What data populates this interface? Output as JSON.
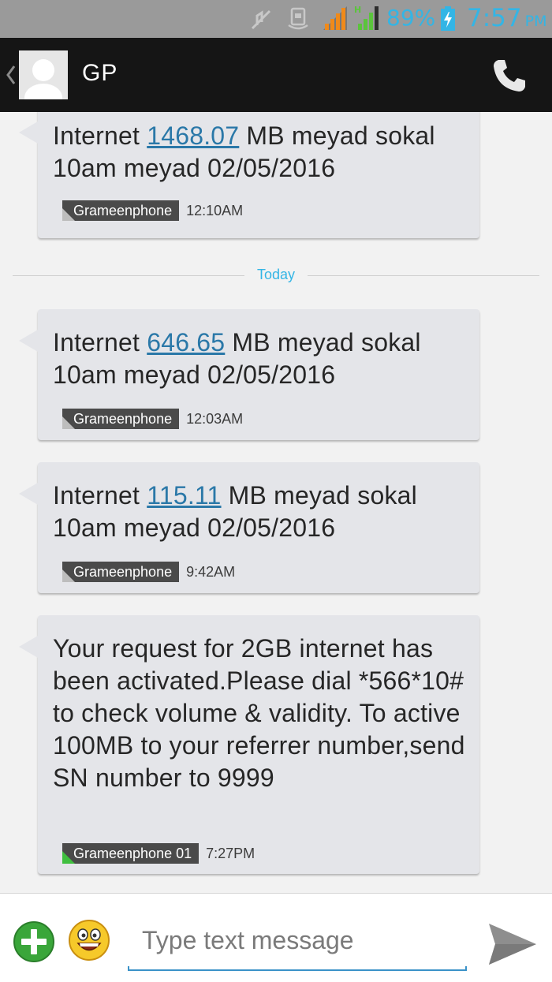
{
  "status_bar": {
    "battery_percent": "89%",
    "time": "7:57",
    "ampm": "PM",
    "network_type": "H",
    "accent_color": "#33b5e5"
  },
  "header": {
    "contact_name": "GP"
  },
  "messages": [
    {
      "prefix": "Internet ",
      "link": "1468.07",
      "suffix": " MB meyad sokal 10am meyad 02/05/2016",
      "sim": "Grameenphone",
      "time": "12:10AM"
    },
    {
      "prefix": "Internet ",
      "link": "646.65",
      "suffix": " MB meyad sokal 10am meyad 02/05/2016",
      "sim": "Grameenphone",
      "time": "12:03AM"
    },
    {
      "prefix": "Internet ",
      "link": "115.11",
      "suffix": " MB meyad sokal 10am meyad 02/05/2016",
      "sim": "Grameenphone",
      "time": "9:42AM"
    },
    {
      "text": "Your request for 2GB internet has been activated.Please dial *566*10# to check volume & validity. To active 100MB to your referrer number,send SN number to 9999",
      "sim": "Grameenphone 01",
      "time": "7:27PM"
    }
  ],
  "date_divider": "Today",
  "compose": {
    "placeholder": "Type text message"
  },
  "icons": {
    "status": [
      "mute-icon",
      "sync-icon",
      "signal-sim1-icon",
      "signal-sim2-icon",
      "battery-charging-icon"
    ],
    "header": [
      "back-icon",
      "avatar-icon",
      "phone-icon"
    ],
    "compose": [
      "attach-plus-icon",
      "emoji-icon",
      "send-icon"
    ]
  }
}
